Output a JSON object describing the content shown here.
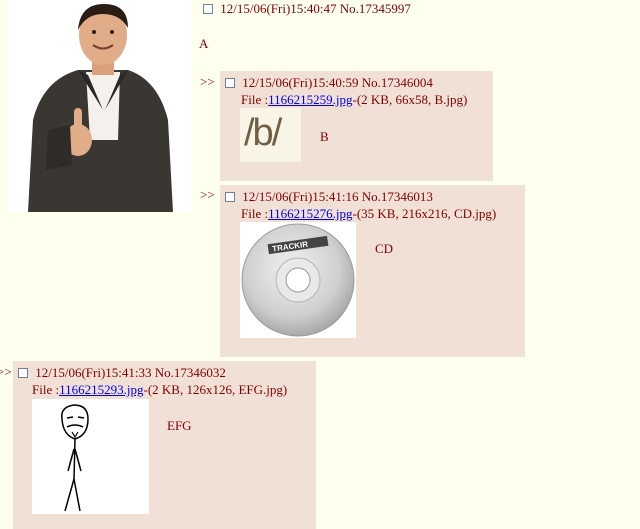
{
  "op": {
    "datetime": "12/15/06(Fri)15:40:47",
    "number": "No.17345997",
    "comment": "A",
    "image_name": "man-thumbs-up-photo"
  },
  "replies": [
    {
      "arrows": ">>",
      "datetime": "12/15/06(Fri)15:40:59",
      "number": "No.17346004",
      "file_label": "File :",
      "file_link": "1166215259.jpg",
      "file_info": "-(2 KB, 66x58, B.jpg)",
      "thumb_text": "/b/",
      "comment": "B"
    },
    {
      "arrows": ">>",
      "datetime": "12/15/06(Fri)15:41:16",
      "number": "No.17346013",
      "file_label": "File :",
      "file_link": "1166215276.jpg",
      "file_info": "-(35 KB, 216x216, CD.jpg)",
      "thumb_text": "TRACKIR",
      "comment": "CD"
    },
    {
      "arrows": ">>",
      "datetime": "12/15/06(Fri)15:41:33",
      "number": "No.17346032",
      "file_label": "File :",
      "file_link": "1166215293.jpg",
      "file_info": "-(2 KB, 126x126, EFG.jpg)",
      "comment": "EFG"
    }
  ]
}
